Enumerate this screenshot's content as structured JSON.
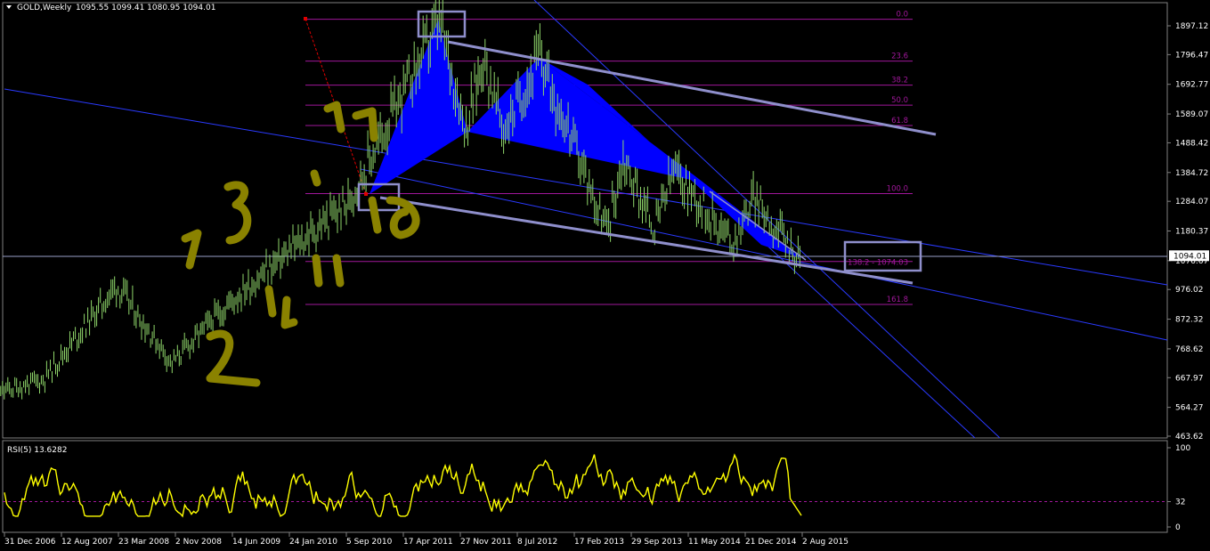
{
  "header": {
    "symbol_timeframe": "GOLD,Weekly",
    "ohlc": "1095.55 1099.41 1080.95 1094.01"
  },
  "price_axis": {
    "ticks": [
      "1897.12",
      "1796.47",
      "1692.77",
      "1589.07",
      "1488.42",
      "1384.72",
      "1284.07",
      "1180.37",
      "1076.67",
      "976.02",
      "872.32",
      "768.62",
      "667.97",
      "564.27",
      "463.62"
    ],
    "current_price_label": "1094.01"
  },
  "rsi_panel": {
    "label": "RSI(5) 13.6282",
    "ticks": [
      "100",
      "32",
      "0"
    ]
  },
  "time_axis": {
    "ticks": [
      "31 Dec 2006",
      "12 Aug 2007",
      "23 Mar 2008",
      "2 Nov 2008",
      "14 Jun 2009",
      "24 Jan 2010",
      "5 Sep 2010",
      "17 Apr 2011",
      "27 Nov 2011",
      "8 Jul 2012",
      "17 Feb 2013",
      "29 Sep 2013",
      "11 May 2014",
      "21 Dec 2014",
      "2 Aug 2015"
    ]
  },
  "fibonacci": {
    "levels": [
      {
        "label": "0.0",
        "price": 1920
      },
      {
        "label": "23.6",
        "price": 1774
      },
      {
        "label": "38.2",
        "price": 1690
      },
      {
        "label": "50.0",
        "price": 1620
      },
      {
        "label": "61.8",
        "price": 1549
      },
      {
        "label": "100.0",
        "price": 1311
      },
      {
        "label": "138.2 - 1074.03",
        "price": 1074
      },
      {
        "label": "161.8",
        "price": 924
      }
    ],
    "color": "#a0179a"
  },
  "annotations": {
    "handwriting_color": "#8a8200",
    "pattern_color": "#0000ff",
    "box_color": "#8f8fcc"
  },
  "chart_data": {
    "type": "line",
    "title": "GOLD,Weekly",
    "xlabel": "",
    "ylabel": "",
    "ylim": [
      463.62,
      1897.12
    ],
    "series": [
      {
        "values": [
          {
            "x": "2006-10-01",
            "y": 600
          },
          {
            "x": "2007-06-01",
            "y": 660
          },
          {
            "x": "2008-03-15",
            "y": 990
          },
          {
            "x": "2008-10-20",
            "y": 720
          },
          {
            "x": "2009-06-14",
            "y": 940
          },
          {
            "x": "2010-01-24",
            "y": 1110
          },
          {
            "x": "2010-09-05",
            "y": 1270
          },
          {
            "x": "2011-09-05",
            "y": 1910
          },
          {
            "x": "2011-12-20",
            "y": 1540
          },
          {
            "x": "2012-02-25",
            "y": 1790
          },
          {
            "x": "2012-05-15",
            "y": 1530
          },
          {
            "x": "2012-10-05",
            "y": 1790
          },
          {
            "x": "2013-06-25",
            "y": 1180
          },
          {
            "x": "2013-08-28",
            "y": 1430
          },
          {
            "x": "2013-12-30",
            "y": 1190
          },
          {
            "x": "2014-03-15",
            "y": 1390
          },
          {
            "x": "2014-11-05",
            "y": 1140
          },
          {
            "x": "2015-01-22",
            "y": 1300
          },
          {
            "x": "2015-07-24",
            "y": 1080
          },
          {
            "x": "2015-08-02",
            "y": 1094
          }
        ]
      }
    ]
  },
  "rsi_data": {
    "ylim": [
      0,
      100
    ],
    "reference_level": 32,
    "last": 13.6282
  }
}
